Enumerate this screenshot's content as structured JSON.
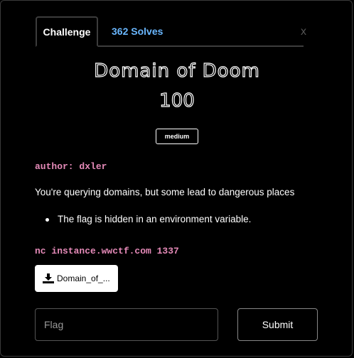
{
  "tabs": {
    "challenge_label": "Challenge",
    "solves_label": "362 Solves"
  },
  "close_label": "x",
  "challenge": {
    "title": "Domain of Doom",
    "points": "100",
    "difficulty": "medium",
    "author_line": "author: dxler",
    "description": "You're querying domains, but some lead to dangerous places",
    "bullets": [
      "The flag is hidden in an environment variable."
    ],
    "connection": "nc instance.wwctf.com 1337"
  },
  "download": {
    "label": "Domain_of_...",
    "icon": "download-icon"
  },
  "flag_input": {
    "placeholder": "Flag",
    "value": ""
  },
  "submit_label": "Submit",
  "colors": {
    "accent_pink": "#e58ab8",
    "solves_blue": "#6ab7ff",
    "background": "#000000"
  }
}
